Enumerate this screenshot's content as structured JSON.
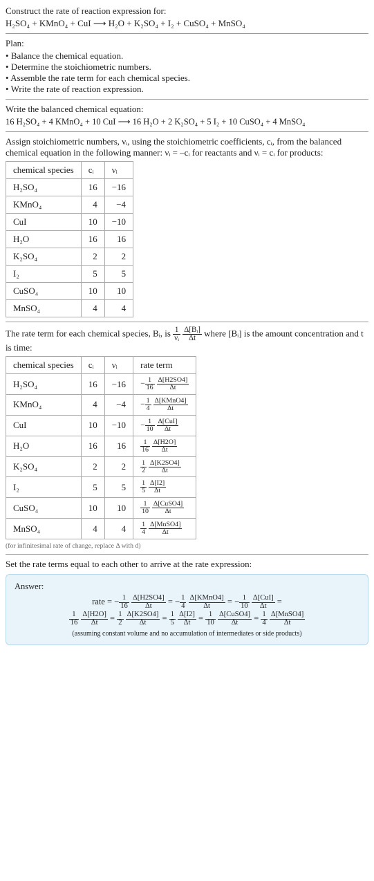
{
  "intro": {
    "line1": "Construct the rate of reaction expression for:",
    "eq_unbalanced": "H₂SO₄ + KMnO₄ + CuI ⟶ H₂O + K₂SO₄ + I₂ + CuSO₄ + MnSO₄"
  },
  "plan": {
    "heading": "Plan:",
    "items": [
      "Balance the chemical equation.",
      "Determine the stoichiometric numbers.",
      "Assemble the rate term for each chemical species.",
      "Write the rate of reaction expression."
    ]
  },
  "balanced": {
    "heading": "Write the balanced chemical equation:",
    "eq": "16 H₂SO₄ + 4 KMnO₄ + 10 CuI ⟶ 16 H₂O + 2 K₂SO₄ + 5 I₂ + 10 CuSO₄ + 4 MnSO₄"
  },
  "assign": {
    "text": "Assign stoichiometric numbers, νᵢ, using the stoichiometric coefficients, cᵢ, from the balanced chemical equation in the following manner: νᵢ = –cᵢ for reactants and νᵢ = cᵢ for products:"
  },
  "table1": {
    "headers": [
      "chemical species",
      "cᵢ",
      "νᵢ"
    ],
    "rows": [
      {
        "species": "H₂SO₄",
        "c": "16",
        "nu": "−16"
      },
      {
        "species": "KMnO₄",
        "c": "4",
        "nu": "−4"
      },
      {
        "species": "CuI",
        "c": "10",
        "nu": "−10"
      },
      {
        "species": "H₂O",
        "c": "16",
        "nu": "16"
      },
      {
        "species": "K₂SO₄",
        "c": "2",
        "nu": "2"
      },
      {
        "species": "I₂",
        "c": "5",
        "nu": "5"
      },
      {
        "species": "CuSO₄",
        "c": "10",
        "nu": "10"
      },
      {
        "species": "MnSO₄",
        "c": "4",
        "nu": "4"
      }
    ]
  },
  "rate_term_intro": {
    "pre": "The rate term for each chemical species, Bᵢ, is ",
    "post": " where [Bᵢ] is the amount concentration and t is time:"
  },
  "table2": {
    "headers": [
      "chemical species",
      "cᵢ",
      "νᵢ",
      "rate term"
    ],
    "rows": [
      {
        "species": "H₂SO₄",
        "c": "16",
        "nu": "−16",
        "sign": "−",
        "coef_top": "1",
        "coef_bot": "16",
        "d_top": "Δ[H2SO4]",
        "d_bot": "Δt"
      },
      {
        "species": "KMnO₄",
        "c": "4",
        "nu": "−4",
        "sign": "−",
        "coef_top": "1",
        "coef_bot": "4",
        "d_top": "Δ[KMnO4]",
        "d_bot": "Δt"
      },
      {
        "species": "CuI",
        "c": "10",
        "nu": "−10",
        "sign": "−",
        "coef_top": "1",
        "coef_bot": "10",
        "d_top": "Δ[CuI]",
        "d_bot": "Δt"
      },
      {
        "species": "H₂O",
        "c": "16",
        "nu": "16",
        "sign": "",
        "coef_top": "1",
        "coef_bot": "16",
        "d_top": "Δ[H2O]",
        "d_bot": "Δt"
      },
      {
        "species": "K₂SO₄",
        "c": "2",
        "nu": "2",
        "sign": "",
        "coef_top": "1",
        "coef_bot": "2",
        "d_top": "Δ[K2SO4]",
        "d_bot": "Δt"
      },
      {
        "species": "I₂",
        "c": "5",
        "nu": "5",
        "sign": "",
        "coef_top": "1",
        "coef_bot": "5",
        "d_top": "Δ[I2]",
        "d_bot": "Δt"
      },
      {
        "species": "CuSO₄",
        "c": "10",
        "nu": "10",
        "sign": "",
        "coef_top": "1",
        "coef_bot": "10",
        "d_top": "Δ[CuSO4]",
        "d_bot": "Δt"
      },
      {
        "species": "MnSO₄",
        "c": "4",
        "nu": "4",
        "sign": "",
        "coef_top": "1",
        "coef_bot": "4",
        "d_top": "Δ[MnSO4]",
        "d_bot": "Δt"
      }
    ]
  },
  "infinitesimal_note": "(for infinitesimal rate of change, replace Δ with d)",
  "set_equal": "Set the rate terms equal to each other to arrive at the rate expression:",
  "answer": {
    "label": "Answer:",
    "rate_prefix": "rate = ",
    "terms": [
      {
        "sign": "−",
        "coef_top": "1",
        "coef_bot": "16",
        "d_top": "Δ[H2SO4]",
        "d_bot": "Δt"
      },
      {
        "sign": "−",
        "coef_top": "1",
        "coef_bot": "4",
        "d_top": "Δ[KMnO4]",
        "d_bot": "Δt"
      },
      {
        "sign": "−",
        "coef_top": "1",
        "coef_bot": "10",
        "d_top": "Δ[CuI]",
        "d_bot": "Δt"
      },
      {
        "sign": "",
        "coef_top": "1",
        "coef_bot": "16",
        "d_top": "Δ[H2O]",
        "d_bot": "Δt"
      },
      {
        "sign": "",
        "coef_top": "1",
        "coef_bot": "2",
        "d_top": "Δ[K2SO4]",
        "d_bot": "Δt"
      },
      {
        "sign": "",
        "coef_top": "1",
        "coef_bot": "5",
        "d_top": "Δ[I2]",
        "d_bot": "Δt"
      },
      {
        "sign": "",
        "coef_top": "1",
        "coef_bot": "10",
        "d_top": "Δ[CuSO4]",
        "d_bot": "Δt"
      },
      {
        "sign": "",
        "coef_top": "1",
        "coef_bot": "4",
        "d_top": "Δ[MnSO4]",
        "d_bot": "Δt"
      }
    ],
    "assumption": "(assuming constant volume and no accumulation of intermediates or side products)"
  }
}
